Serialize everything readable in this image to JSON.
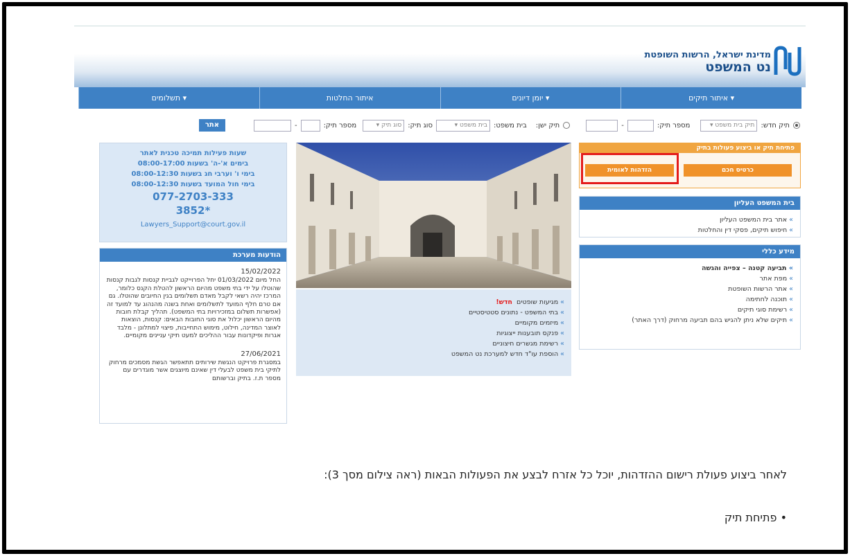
{
  "header": {
    "org_line": "מדינת ישראל, הרשות השופטת",
    "site_name": "נט המשפט"
  },
  "nav": [
    {
      "label": "איתור תיקים ▾"
    },
    {
      "label": "יומן דיונים ▾"
    },
    {
      "label": "איתור החלטות"
    },
    {
      "label": "תשלומים ▾"
    }
  ],
  "search": {
    "new_case_label": "תיק חדש:",
    "court_type_value": "תיק בית משפט",
    "case_number_label": "מספר תיק:",
    "old_case_label": "תיק ישן:",
    "court_label": "בית משפט:",
    "court_value": "בית משפט",
    "case_type_label": "סוג תיק:",
    "case_type_value": "סוג תיק",
    "number_label": "מספר תיק:",
    "search_button": "אתר",
    "dash": "-"
  },
  "actions": {
    "header": "פתיחת תיק או ביצוע פעולות בתיק",
    "btn_left_label": "הזדהות לאומית",
    "btn_right_label": "כרטיס חכם"
  },
  "supreme": {
    "header": "בית המשפט העליון",
    "items": [
      "אתר בית המשפט העליון",
      "חיפוש תיקים, פסקי דין והחלטות"
    ]
  },
  "general": {
    "header": "מידע כללי",
    "items": [
      "תביעה קטנה – צפייה והגשה",
      "מפת אתר",
      "אתר הרשות השופטת",
      "תוכנה לחתימה",
      "רשימת סוגי תיקים",
      "תיקים שלא ניתן להגיש בהם תביעה מרחוק (דרך האתר)"
    ]
  },
  "support": {
    "line1": "שעות פעילות תמיכה טכנית לאתר",
    "line2": "בימים א'-ה' בשעות 08:00-17:00",
    "line3": "בימי ו' וערבי חג בשעות 08:00-12:30",
    "line4": "בימי חול המועד בשעות 08:00-12:30",
    "phone": "077-2703-333",
    "short_phone": "*3852",
    "email": "Lawyers_Support@court.gov.il"
  },
  "news": {
    "header": "הודעות מערכת",
    "items": [
      {
        "date": "15/02/2022",
        "text": "החל מיום 01/03/2022 יחל הפרוייקט לגביית קנסות לגבות קנסות שהוטלו על ידי בתי משפט מהיום הראשון להטלת הקנס כלומר, המרכז יהיה רשאי לקבל מאדם תשלומים בגין החיובים שהוטלו. גם אם טרם חלף המועד לתשלומים ואחת בשנה מהנהוג עד למועד זה (אפשרות תשלום במזכירויות בתי המשפט). תהליך קבלת חובות מהיום הראשון יכלול את סוגי החובות הבאים: קנסות, הוצאות לאוצר המדינה, חילוט, מימוש התחייבות, פיצוי למתלונן - מלבד אגרות ופיקדונות עבור ההליכים למעט תיקי עניינים מקומיים."
      },
      {
        "date": "27/06/2021",
        "text": "במסגרת פרויקט הנגשת שירותים תתאפשר הגשת מסמכים מרחוק לתיקי בית משפט לבעלי דין שאינם מיוצגים אשר מוגדרים עם מספר ת.ז. בתיק וברשותם"
      }
    ]
  },
  "center_links": {
    "new_badge": "חדש!",
    "items": [
      "מגיעות שופטים",
      "בתי המשפט - נתונים סטטיסטיים",
      "מיזמים מקומיים",
      "פנקס תובענות ייצוגיות",
      "רשימת מגשרים חיצוניים",
      "הוספת עו\"ד חדש למערכת נט המשפט"
    ]
  },
  "doc": {
    "paragraph": "לאחר ביצוע פעולת רישום ההזדהות, יוכל כל אזרח לבצע את הפעולות הבאות (ראה צילום מסך 3):",
    "bullet": "• פתיחת תיק"
  },
  "colors": {
    "nav_blue": "#3e81c5",
    "orange": "#f0922a",
    "highlight_red": "#e41b1b"
  }
}
